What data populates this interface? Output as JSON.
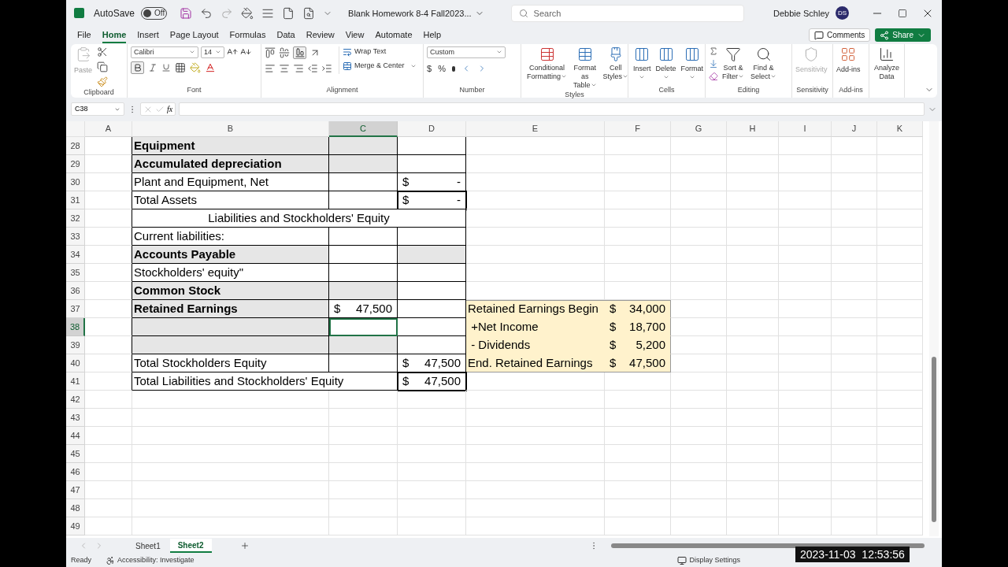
{
  "title_bar": {
    "autosave_label": "AutoSave",
    "autosave_state": "Off",
    "autosave_on": false,
    "document_title": "Blank Homework 8-4 Fall2023...",
    "search": {
      "placeholder": "Search"
    },
    "user_name": "Debbie Schley",
    "user_initials": "DS"
  },
  "menu_tabs": [
    {
      "label": "File",
      "selected": false
    },
    {
      "label": "Home",
      "selected": true
    },
    {
      "label": "Insert",
      "selected": false
    },
    {
      "label": "Page Layout",
      "selected": false
    },
    {
      "label": "Formulas",
      "selected": false
    },
    {
      "label": "Data",
      "selected": false
    },
    {
      "label": "Review",
      "selected": false
    },
    {
      "label": "View",
      "selected": false
    },
    {
      "label": "Automate",
      "selected": false
    },
    {
      "label": "Help",
      "selected": false
    }
  ],
  "comments_button": "Comments",
  "share_button": "Share",
  "ribbon": {
    "clipboard": {
      "paste": "Paste",
      "group": "Clipboard"
    },
    "font": {
      "name": "Calibri",
      "size": "14",
      "bold_selected": true,
      "group": "Font"
    },
    "alignment": {
      "wrap_text": "Wrap Text",
      "merge_center": "Merge & Center",
      "bottom_align_selected": true,
      "group": "Alignment"
    },
    "number": {
      "format": "Custom",
      "currency": "$",
      "percent": "%",
      "group": "Number"
    },
    "styles": {
      "items": [
        {
          "lines": [
            "Conditional",
            "Formatting"
          ]
        },
        {
          "lines": [
            "Format as",
            "Table"
          ]
        },
        {
          "lines": [
            "Cell",
            "Styles"
          ]
        }
      ],
      "group": "Styles"
    },
    "cells": {
      "items": [
        "Insert",
        "Delete",
        "Format"
      ],
      "group": "Cells"
    },
    "editing": {
      "items": [
        {
          "lines": [
            "Sort &",
            "Filter"
          ]
        },
        {
          "lines": [
            "Find &",
            "Select"
          ]
        }
      ],
      "group": "Editing"
    },
    "sensitivity": {
      "label": "Sensitivity",
      "disabled": true,
      "group": "Sensitivity"
    },
    "addins": {
      "label": "Add-ins",
      "group": "Add-ins"
    },
    "analyze": {
      "lines": [
        "Analyze",
        "Data"
      ]
    }
  },
  "formula_bar": {
    "name_box": "C38",
    "fx": "fx"
  },
  "columns": [
    {
      "label": "A",
      "selected": false
    },
    {
      "label": "B",
      "selected": false
    },
    {
      "label": "C",
      "selected": true
    },
    {
      "label": "D",
      "selected": false
    },
    {
      "label": "E",
      "selected": false
    },
    {
      "label": "F",
      "selected": false
    },
    {
      "label": "G",
      "selected": false
    },
    {
      "label": "H",
      "selected": false
    },
    {
      "label": "I",
      "selected": false
    },
    {
      "label": "J",
      "selected": false
    },
    {
      "label": "K",
      "selected": false
    }
  ],
  "rows": [
    {
      "number": "28",
      "selected": false,
      "kind": "item",
      "label": {
        "text": "Equipment",
        "bold": true,
        "shaded": true
      },
      "c": {
        "shaded": true
      },
      "d": {
        "shaded": false
      }
    },
    {
      "number": "29",
      "selected": false,
      "kind": "item",
      "label": {
        "text": "Accumulated depreciation",
        "bold": true,
        "shaded": true
      },
      "c": {
        "shaded": true
      },
      "d": {
        "shaded": false
      }
    },
    {
      "number": "30",
      "selected": false,
      "kind": "item",
      "label": {
        "text": "Plant and Equipment, Net",
        "bold": false,
        "shaded": false
      },
      "c": {
        "shaded": false
      },
      "d": {
        "shaded": false,
        "currency": "$",
        "amount": "-"
      }
    },
    {
      "number": "31",
      "selected": false,
      "kind": "item",
      "label": {
        "text": "Total Assets",
        "bold": false,
        "shaded": false
      },
      "c": {
        "shaded": false
      },
      "d": {
        "shaded": false,
        "currency": "$",
        "amount": "-",
        "outlined": true
      }
    },
    {
      "number": "32",
      "selected": false,
      "kind": "heading",
      "label": {
        "text": "Liabilities and Stockholders' Equity",
        "bold": false,
        "shaded": false
      }
    },
    {
      "number": "33",
      "selected": false,
      "kind": "item",
      "label": {
        "text": "Current liabilities:",
        "bold": false,
        "shaded": false
      },
      "c": {
        "shaded": false
      },
      "d": {
        "shaded": false
      }
    },
    {
      "number": "34",
      "selected": false,
      "kind": "item",
      "label": {
        "text": "Accounts Payable",
        "bold": true,
        "shaded": true
      },
      "c": {
        "shaded": false
      },
      "d": {
        "shaded": true
      }
    },
    {
      "number": "35",
      "selected": false,
      "kind": "item",
      "label": {
        "text": "Stockholders' equity\"",
        "bold": false,
        "shaded": false
      },
      "c": {
        "shaded": false
      },
      "d": {
        "shaded": false
      }
    },
    {
      "number": "36",
      "selected": false,
      "kind": "item",
      "label": {
        "text": "Common Stock",
        "bold": true,
        "shaded": true
      },
      "c": {
        "shaded": true
      },
      "d": {
        "shaded": false
      }
    },
    {
      "number": "37",
      "selected": false,
      "kind": "item",
      "label": {
        "text": "Retained Earnings",
        "bold": true,
        "shaded": true
      },
      "c": {
        "shaded": false,
        "currency": "$",
        "amount": "47,500"
      },
      "d": {
        "shaded": false
      },
      "summary": {
        "label": "Retained Earnings Begin",
        "currency": "$",
        "amount": "34,000"
      }
    },
    {
      "number": "38",
      "selected": true,
      "kind": "item",
      "label": {
        "shaded": true
      },
      "c": {
        "shaded": false
      },
      "d": {
        "shaded": false
      },
      "summary": {
        "label": " +Net Income",
        "currency": "$",
        "amount": "18,700"
      }
    },
    {
      "number": "39",
      "selected": false,
      "kind": "item",
      "label": {
        "shaded": true
      },
      "c": {
        "shaded": true
      },
      "d": {
        "shaded": false
      },
      "summary": {
        "label": " - Dividends",
        "currency": "$",
        "amount": "5,200"
      }
    },
    {
      "number": "40",
      "selected": false,
      "kind": "item",
      "label": {
        "text": "Total Stockholders Equity",
        "bold": false,
        "shaded": false
      },
      "c": {
        "shaded": false
      },
      "d": {
        "shaded": false,
        "currency": "$",
        "amount": "47,500"
      },
      "summary": {
        "label": "End. Retained Earnings",
        "currency": "$",
        "amount": "47,500"
      }
    },
    {
      "number": "41",
      "selected": false,
      "kind": "total",
      "label": {
        "text": "Total Liabilities and Stockholders' Equity",
        "bold": false,
        "shaded": false
      },
      "d": {
        "shaded": false,
        "currency": "$",
        "amount": "47,500",
        "outlined": true
      }
    },
    {
      "number": "42",
      "selected": false,
      "kind": "blank"
    },
    {
      "number": "43",
      "selected": false,
      "kind": "blank"
    },
    {
      "number": "44",
      "selected": false,
      "kind": "blank"
    },
    {
      "number": "45",
      "selected": false,
      "kind": "blank"
    },
    {
      "number": "46",
      "selected": false,
      "kind": "blank"
    },
    {
      "number": "47",
      "selected": false,
      "kind": "blank"
    },
    {
      "number": "48",
      "selected": false,
      "kind": "blank"
    },
    {
      "number": "49",
      "selected": false,
      "kind": "blank"
    }
  ],
  "sheet_tabs": [
    {
      "label": "Sheet1",
      "selected": false
    },
    {
      "label": "Sheet2",
      "selected": true
    }
  ],
  "status_bar": {
    "mode": "Ready",
    "accessibility": "Accessibility: Investigate",
    "display_settings": "Display Settings"
  },
  "recording_timestamp": "2023-11-03  12:53:56"
}
